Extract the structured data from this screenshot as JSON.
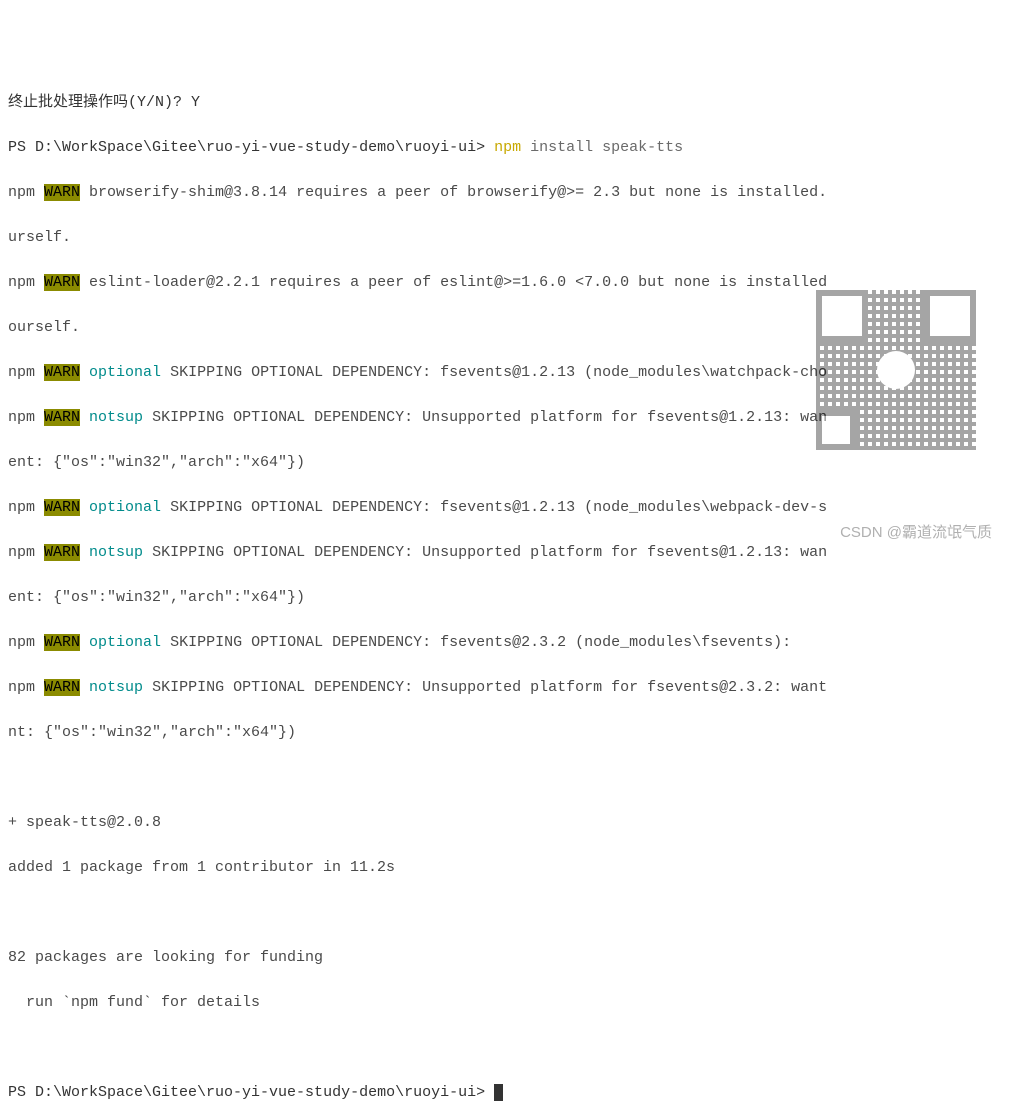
{
  "prompt1": {
    "question": "终止批处理操作吗(Y/N)? ",
    "answer": "Y"
  },
  "ps_line": {
    "prefix": "PS ",
    "path": "D:\\WorkSpace\\Gitee\\ruo-yi-vue-study-demo\\ruoyi-ui",
    "sep": "> ",
    "cmd": "npm",
    "args": " install speak-tts"
  },
  "npm_prefix": "npm ",
  "warn": "WARN",
  "optional": "optional",
  "notsup": "notsup",
  "warn_browserify": " browserify-shim@3.8.14 requires a peer of browserify@>= 2.3 but none is installed.",
  "warn_browserify2": "urself.",
  "warn_eslint": " eslint-loader@2.2.1 requires a peer of eslint@>=1.6.0 <7.0.0 but none is installed",
  "warn_eslint2": "ourself.",
  "skip1": " SKIPPING OPTIONAL DEPENDENCY: fsevents@1.2.13 (node_modules\\watchpack-cho",
  "notsup1": " SKIPPING OPTIONAL DEPENDENCY: Unsupported platform for fsevents@1.2.13: wan",
  "ent1": "ent: {\"os\":\"win32\",\"arch\":\"x64\"})",
  "skip2": " SKIPPING OPTIONAL DEPENDENCY: fsevents@1.2.13 (node_modules\\webpack-dev-s",
  "notsup2": " SKIPPING OPTIONAL DEPENDENCY: Unsupported platform for fsevents@1.2.13: wan",
  "ent2": "ent: {\"os\":\"win32\",\"arch\":\"x64\"})",
  "skip3": " SKIPPING OPTIONAL DEPENDENCY: fsevents@2.3.2 (node_modules\\fsevents):",
  "notsup3": " SKIPPING OPTIONAL DEPENDENCY: Unsupported platform for fsevents@2.3.2: want",
  "ent3": "nt: {\"os\":\"win32\",\"arch\":\"x64\"})",
  "install_result": {
    "plus": "+ speak-tts@2.0.8",
    "added": "added 1 package from 1 contributor in 11.2s"
  },
  "funding": {
    "line1": "82 packages are looking for funding",
    "line2": "  run `npm fund` for details"
  },
  "ps_line2": {
    "prefix": "PS ",
    "path": "D:\\WorkSpace\\Gitee\\ruo-yi-vue-study-demo\\ruoyi-ui",
    "sep": "> "
  },
  "watermark": "CSDN @霸道流氓气质"
}
